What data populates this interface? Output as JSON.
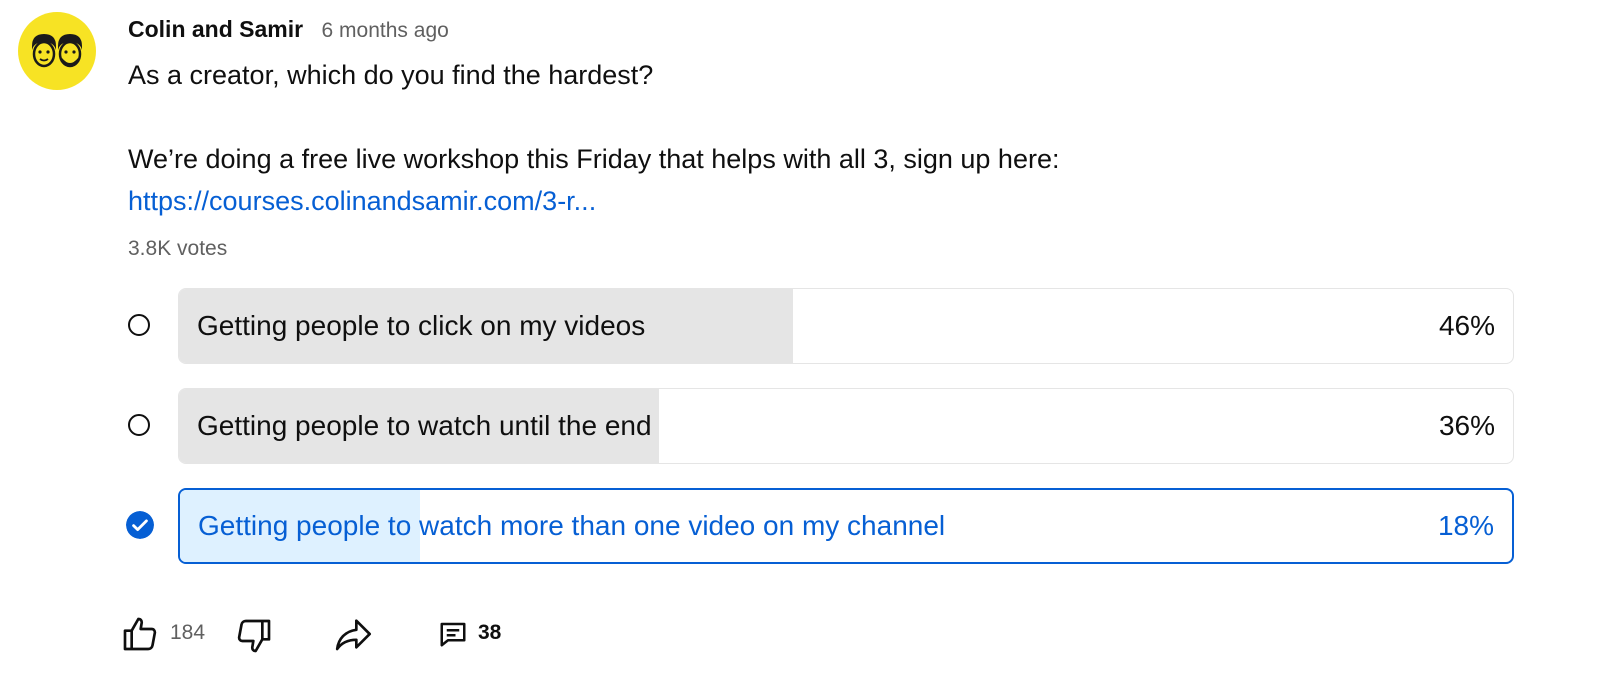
{
  "post": {
    "author": "Colin and Samir",
    "time": "6 months ago",
    "question": "As a creator, which do you find the hardest?",
    "body": "We’re doing a free live workshop this Friday that helps with all 3, sign up here:",
    "link": "https://courses.colinandsamir.com/3-r...",
    "votes": "3.8K votes"
  },
  "poll": {
    "options": [
      {
        "label": "Getting people to click on my videos",
        "percent_text": "46%",
        "percent": 46,
        "selected": false
      },
      {
        "label": "Getting people to watch until the end",
        "percent_text": "36%",
        "percent": 36,
        "selected": false
      },
      {
        "label": "Getting people to watch more than one video on my channel",
        "percent_text": "18%",
        "percent": 18,
        "selected": true
      }
    ]
  },
  "actions": {
    "likes": "184",
    "comments": "38",
    "icons": [
      "thumbs-up-icon",
      "thumbs-down-icon",
      "share-icon",
      "comment-icon"
    ]
  },
  "colors": {
    "avatar_bg": "#f7e324",
    "accent": "#065fd4",
    "bar_fill": "#e5e5e5",
    "selected_fill": "#def1ff"
  }
}
